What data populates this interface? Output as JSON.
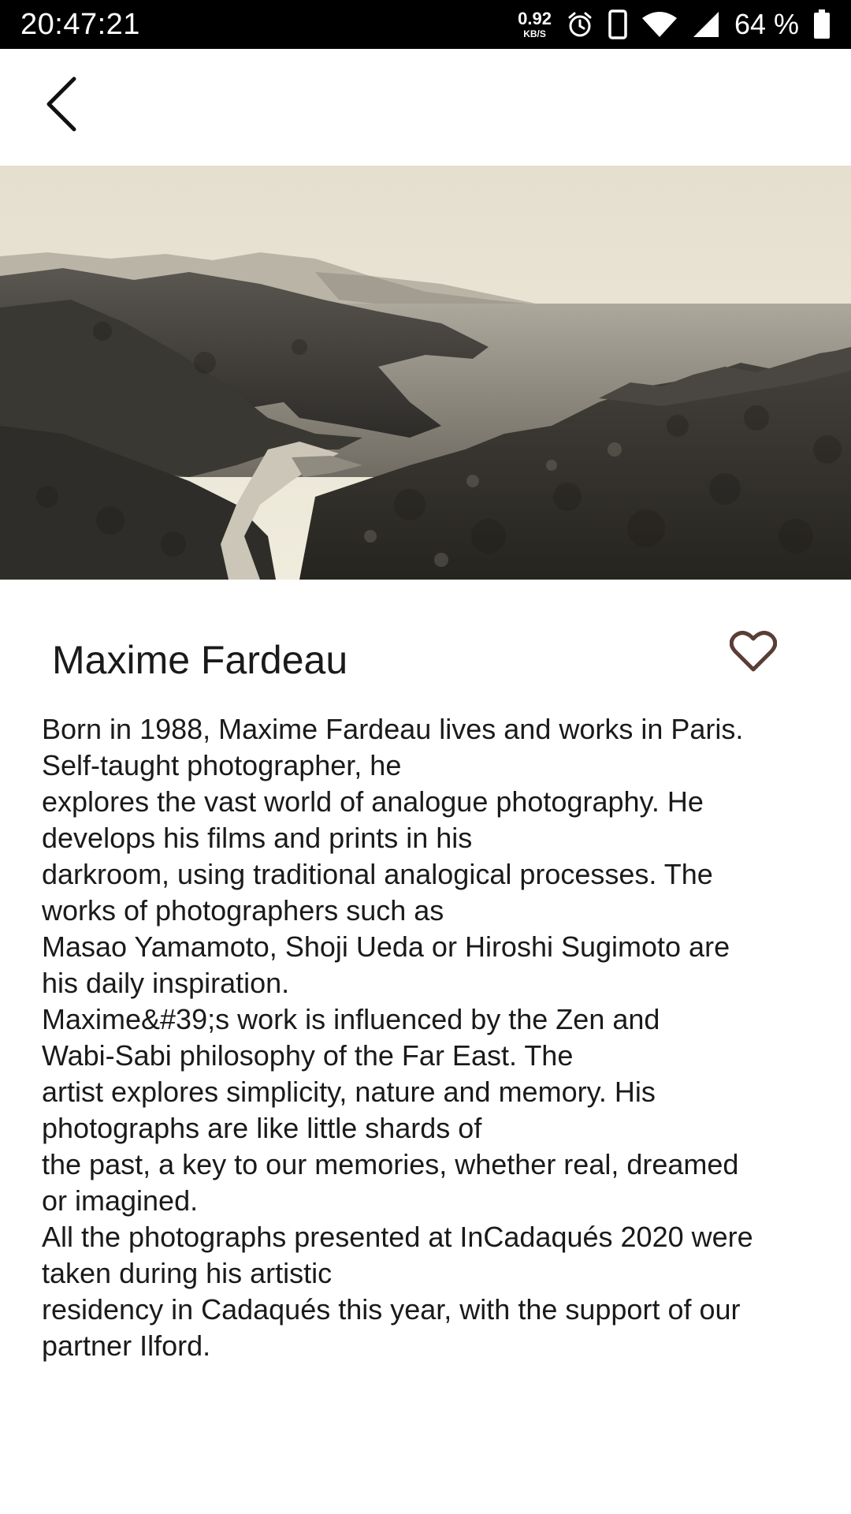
{
  "status_bar": {
    "time": "20:47:21",
    "net_speed_value": "0.92",
    "net_speed_unit": "KB/S",
    "battery_percent": "64 %",
    "icons": [
      "alarm-icon",
      "phone-icon",
      "wifi-icon",
      "signal-icon",
      "battery-icon"
    ]
  },
  "app_bar": {
    "back_icon": "chevron-left-icon"
  },
  "hero_image": {
    "description_icon": "landscape-photo"
  },
  "artist": {
    "name": "Maxime Fardeau",
    "favorite_icon": "heart-outline-icon",
    "favorite_color": "#5a3e36"
  },
  "bio": {
    "lines": [
      "Born in 1988, Maxime Fardeau lives and works in Paris.",
      "Self-taught photographer, he",
      "explores the vast world of analogue photography. He",
      "develops his films and prints in his",
      "darkroom, using traditional analogical processes. The",
      "works of photographers such as",
      "Masao Yamamoto, Shoji Ueda or Hiroshi Sugimoto are",
      "his daily inspiration.",
      "Maxime&#39;s work is influenced by the Zen and",
      "Wabi-Sabi philosophy of the Far East. The",
      "artist explores simplicity, nature and memory. His",
      "photographs are like little shards of",
      "the past, a key to our memories, whether real, dreamed",
      "or imagined.",
      "All the photographs presented at InCadaqués 2020 were",
      "taken during his artistic",
      "residency in Cadaqués this year, with the support of our",
      "partner Ilford."
    ]
  }
}
